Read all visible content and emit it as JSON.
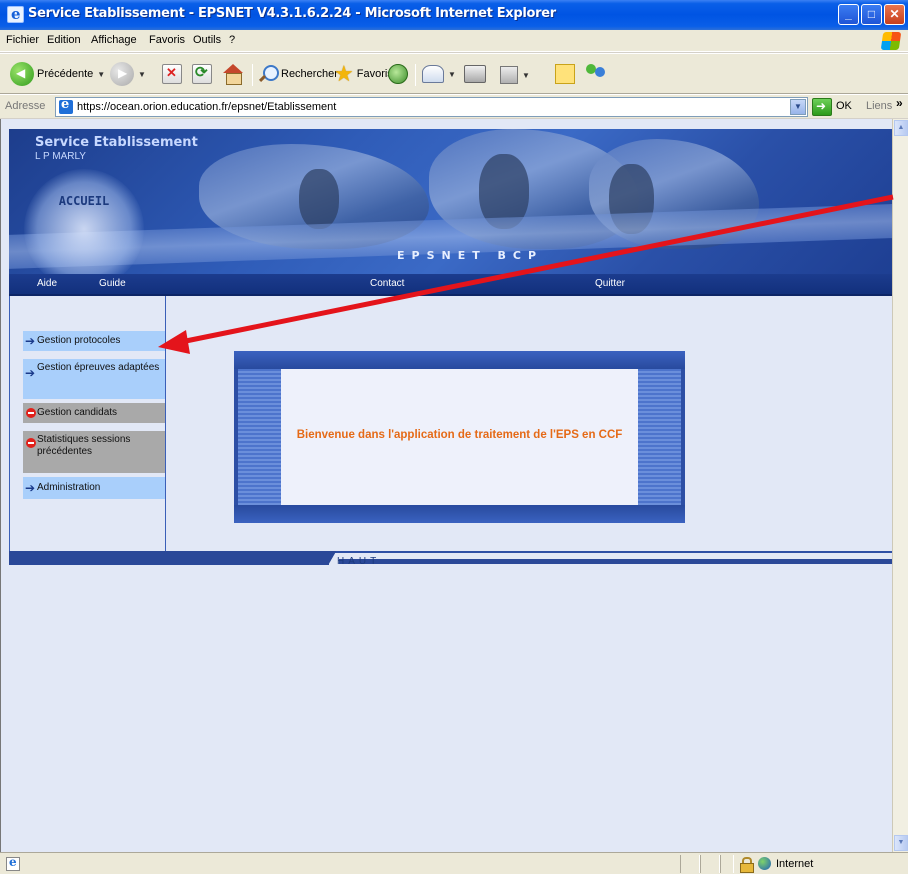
{
  "window": {
    "title": "Service Etablissement - EPSNET V4.3.1.6.2.24 - Microsoft Internet Explorer"
  },
  "menubar": {
    "items": [
      "Fichier",
      "Edition",
      "Affichage",
      "Favoris",
      "Outils",
      "?"
    ]
  },
  "toolbar": {
    "back_label": "Précédente",
    "search_label": "Rechercher",
    "favorites_label": "Favoris"
  },
  "addressbar": {
    "label": "Adresse",
    "url": "https://ocean.orion.education.fr/epsnet/Etablissement",
    "go_label": "OK",
    "links_label": "Liens"
  },
  "banner": {
    "service_title": "Service Etablissement",
    "school_name": "L P MARLY",
    "home_button": "ACCUEIL",
    "brand": "EPSNET BCP"
  },
  "nav": {
    "help": "Aide",
    "guide": "Guide",
    "contact": "Contact",
    "quit": "Quitter"
  },
  "sidebar": {
    "items": [
      {
        "label": "Gestion protocoles",
        "state": "active",
        "icon": "arrow-right-icon"
      },
      {
        "label": "Gestion épreuves adaptées",
        "state": "active",
        "icon": "arrow-right-icon"
      },
      {
        "label": "Gestion candidats",
        "state": "disabled",
        "icon": "no-entry-icon"
      },
      {
        "label": "Statistiques sessions précédentes",
        "state": "disabled",
        "icon": "no-entry-icon"
      },
      {
        "label": "Administration",
        "state": "active",
        "icon": "arrow-right-icon"
      }
    ]
  },
  "main": {
    "welcome": "Bienvenue dans l'application de traitement de l'EPS en CCF"
  },
  "footer": {
    "top_link": "HAUT"
  },
  "statusbar": {
    "zone": "Internet"
  },
  "colors": {
    "accent": "#2d4fa5",
    "welcome_text": "#e56a17",
    "menu_active": "#a9cffb",
    "menu_disabled": "#a9a9a9",
    "annotation_arrow": "#e4141b"
  }
}
